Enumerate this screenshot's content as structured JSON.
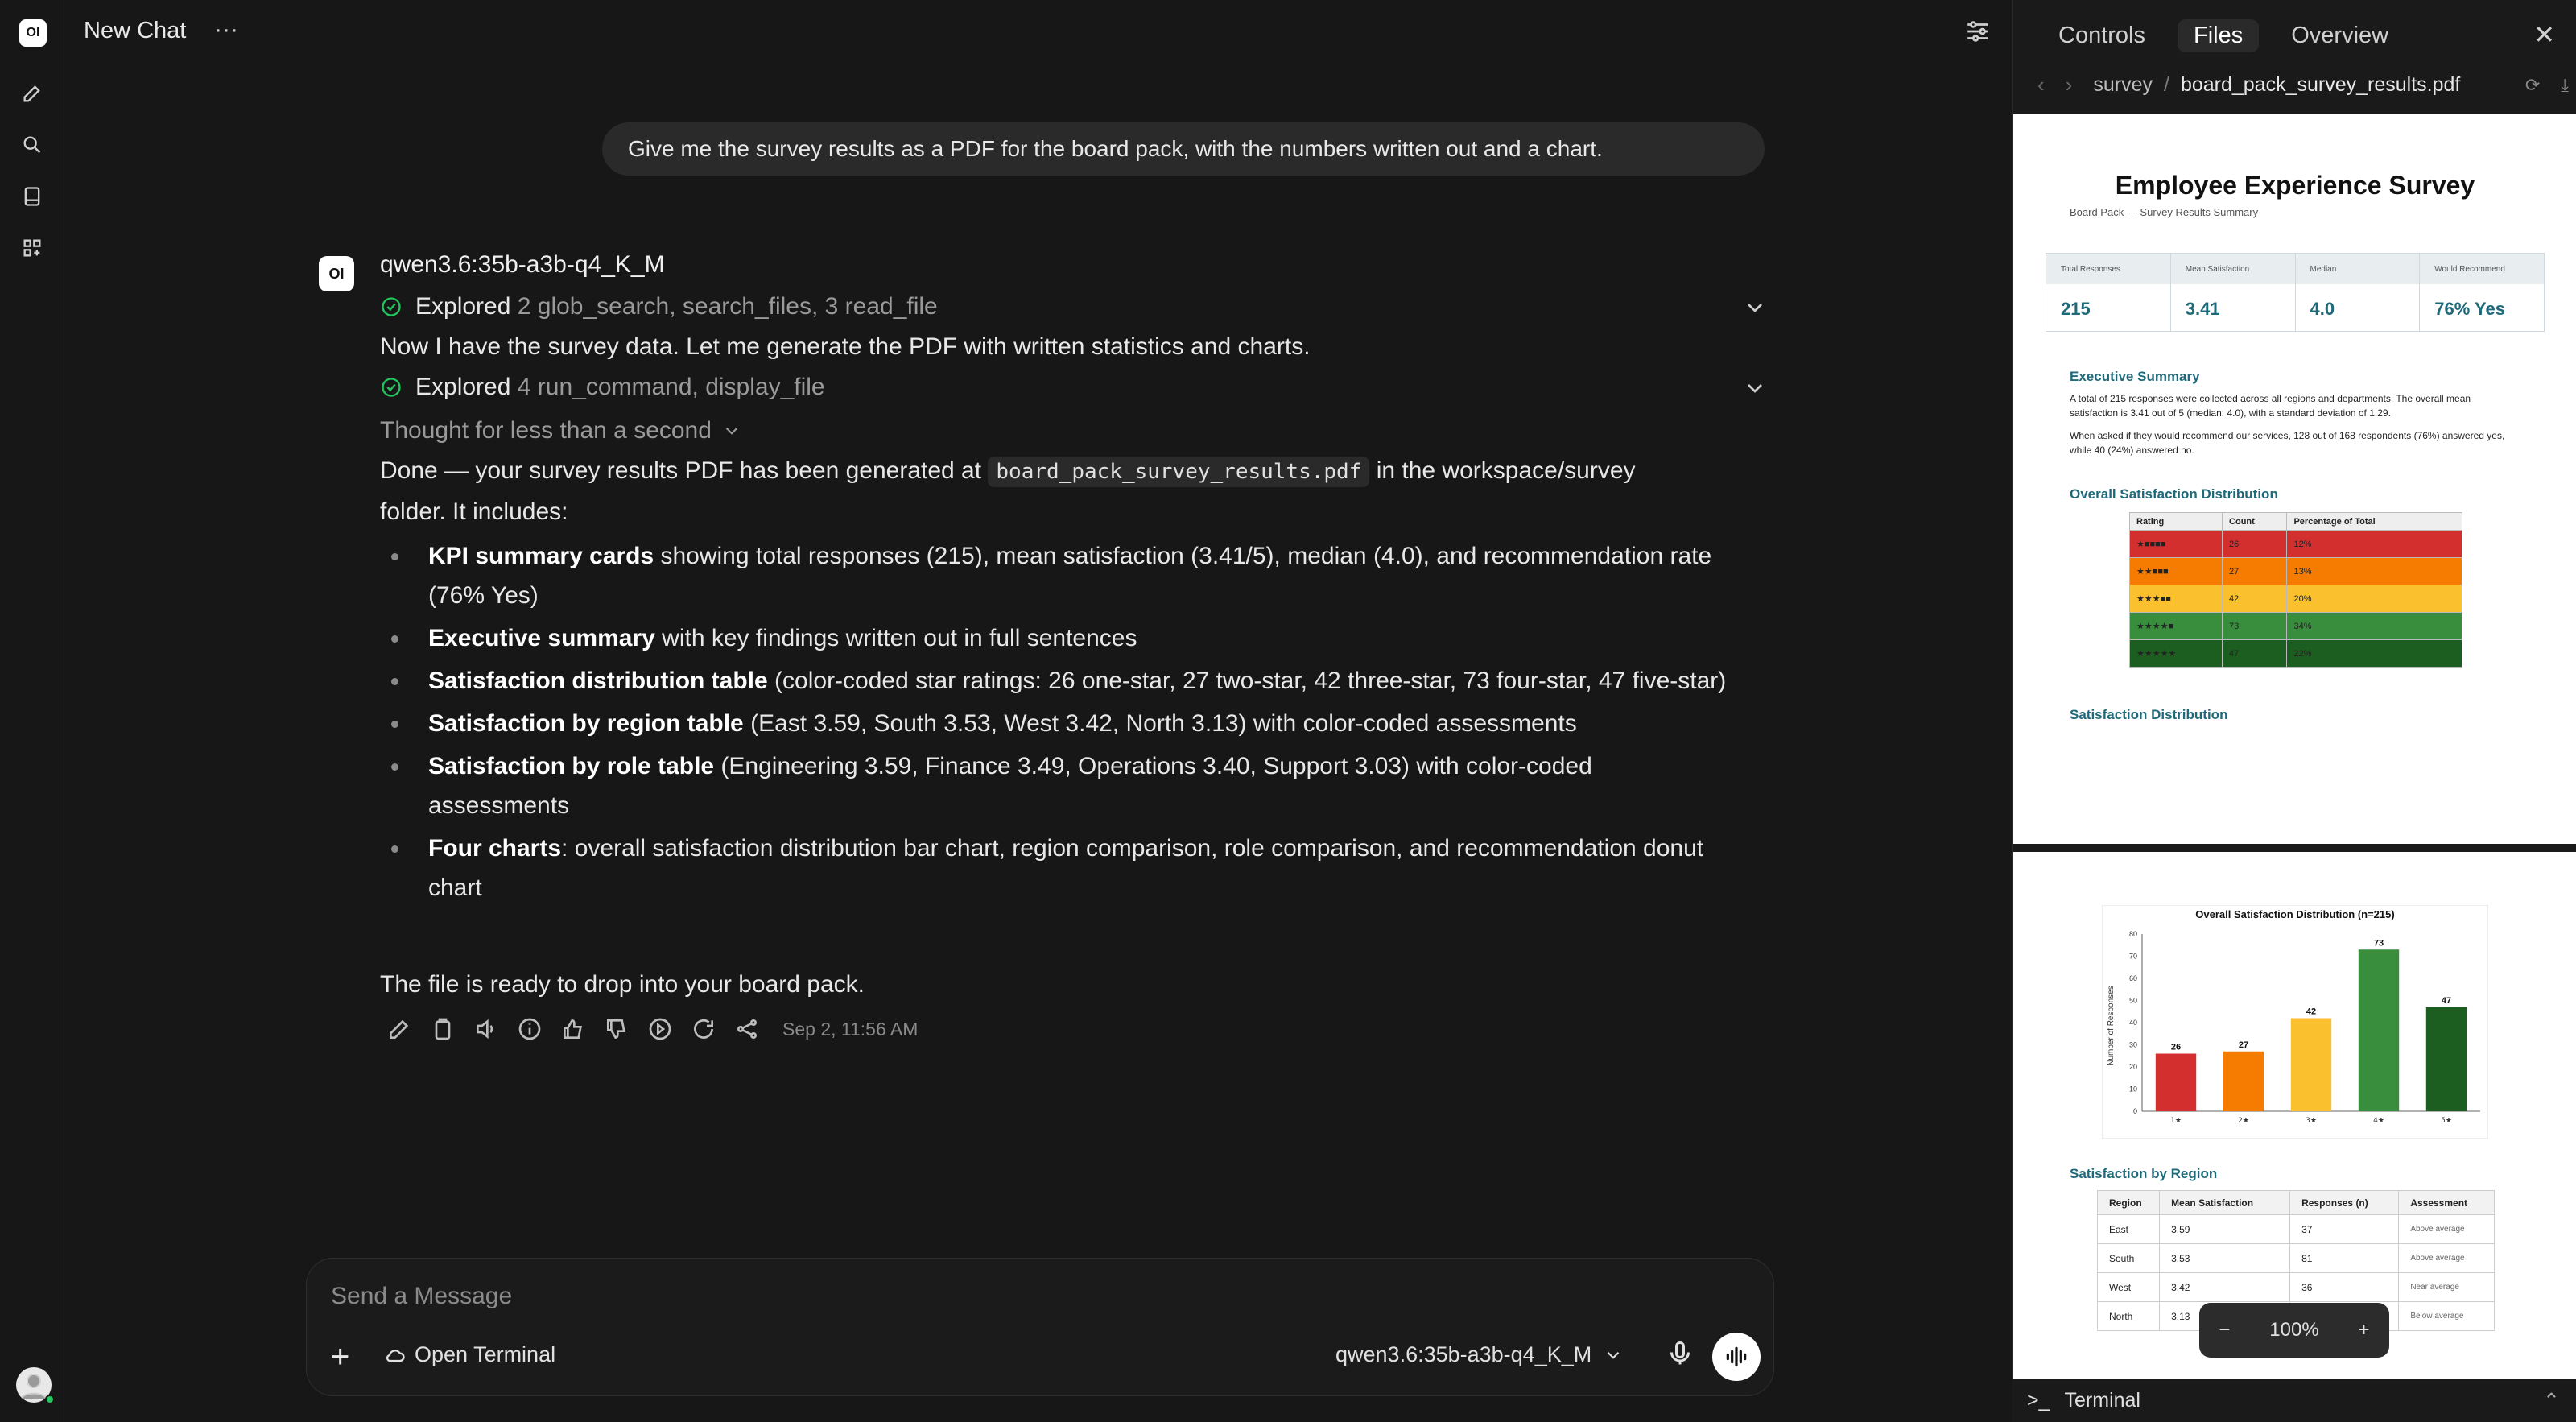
{
  "header": {
    "title": "New Chat",
    "more": "···"
  },
  "chat": {
    "user_message": "Give me the survey results as a PDF for the board pack, with the numbers written out and a chart.",
    "model_name": "qwen3.6:35b-a3b-q4_K_M",
    "explored1_label": "Explored",
    "explored1_detail": "2 glob_search, search_files, 3 read_file",
    "line1": "Now I have the survey data. Let me generate the PDF with written statistics and charts.",
    "explored2_label": "Explored",
    "explored2_detail": "4 run_command, display_file",
    "thought": "Thought for less than a second",
    "done_pre": "Done — your survey results PDF has been generated at",
    "done_code": "board_pack_survey_results.pdf",
    "done_post": "in the workspace/survey",
    "done_line2": "folder. It includes:",
    "bullets": [
      {
        "b": "KPI summary cards",
        "t": " showing total responses (215), mean satisfaction (3.41/5), median (4.0), and recommendation rate (76% Yes)"
      },
      {
        "b": "Executive summary",
        "t": " with key findings written out in full sentences"
      },
      {
        "b": "Satisfaction distribution table",
        "t": " (color-coded star ratings: 26 one-star, 27 two-star, 42 three-star, 73 four-star, 47 five-star)"
      },
      {
        "b": "Satisfaction by region table",
        "t": " (East 3.59, South 3.53, West 3.42, North 3.13) with color-coded assessments"
      },
      {
        "b": "Satisfaction by role table",
        "t": " (Engineering 3.59, Finance 3.49, Operations 3.40, Support 3.03) with color-coded assessments"
      },
      {
        "b": "Four charts",
        "t": ": overall satisfaction distribution bar chart, region comparison, role comparison, and recommendation donut chart"
      }
    ],
    "closing": "The file is ready to drop into your board pack.",
    "timestamp": "Sep 2, 11:56 AM"
  },
  "composer": {
    "placeholder": "Send a Message",
    "terminal_label": "Open Terminal",
    "model": "qwen3.6:35b-a3b-q4_K_M"
  },
  "panel": {
    "tabs": [
      "Controls",
      "Files",
      "Overview"
    ],
    "crumb_folder": "survey",
    "crumb_sep": "/",
    "crumb_file": "board_pack_survey_results.pdf",
    "zoom": "100%",
    "zoom_minus": "−",
    "zoom_plus": "+",
    "terminal": "Terminal"
  },
  "pdf": {
    "title": "Employee Experience Survey",
    "subtitle": "Board Pack — Survey Results Summary",
    "kpis": [
      {
        "label": "Total Responses",
        "value": "215"
      },
      {
        "label": "Mean Satisfaction",
        "value": "3.41"
      },
      {
        "label": "Median",
        "value": "4.0"
      },
      {
        "label": "Would Recommend",
        "value": "76% Yes"
      }
    ],
    "exec_heading": "Executive Summary",
    "exec_p1": "A total of 215 responses were collected across all regions and departments. The overall mean satisfaction is 3.41 out of 5 (median: 4.0), with a standard deviation of 1.29.",
    "exec_p2": "When asked if they would recommend our services, 128 out of 168 respondents (76%) answered yes, while 40 (24%) answered no.",
    "dist_heading": "Overall Satisfaction Distribution",
    "dist_cols": [
      "Rating",
      "Count",
      "Percentage of Total"
    ],
    "dist_rows": [
      {
        "rating": "★■■■■",
        "count": "26",
        "pct": "12%",
        "color": "#d32f2f"
      },
      {
        "rating": "★★■■■",
        "count": "27",
        "pct": "13%",
        "color": "#f57c00"
      },
      {
        "rating": "★★★■■",
        "count": "42",
        "pct": "20%",
        "color": "#fbc02d"
      },
      {
        "rating": "★★★★■",
        "count": "73",
        "pct": "34%",
        "color": "#388e3c"
      },
      {
        "rating": "★★★★★",
        "count": "47",
        "pct": "22%",
        "color": "#1b5e20"
      }
    ],
    "sat_dist_heading": "Satisfaction Distribution",
    "region_heading": "Satisfaction by Region",
    "region_cols": [
      "Region",
      "Mean Satisfaction",
      "Responses (n)",
      "Assessment"
    ],
    "region_rows": [
      {
        "region": "East",
        "mean": "3.59",
        "n": "37",
        "assess": "Above average"
      },
      {
        "region": "South",
        "mean": "3.53",
        "n": "81",
        "assess": "Above average"
      },
      {
        "region": "West",
        "mean": "3.42",
        "n": "36",
        "assess": "Near average"
      },
      {
        "region": "North",
        "mean": "3.13",
        "n": "",
        "assess": "Below average"
      }
    ]
  },
  "chart_data": {
    "type": "bar",
    "title": "Overall Satisfaction Distribution (n=215)",
    "categories": [
      "1★",
      "2★",
      "3★",
      "4★",
      "5★"
    ],
    "values": [
      26,
      27,
      42,
      73,
      47
    ],
    "colors": [
      "#d32f2f",
      "#f57c00",
      "#fbc02d",
      "#388e3c",
      "#1b5e20"
    ],
    "ylabel": "Number of Responses",
    "yticks": [
      "0",
      "10",
      "20",
      "30",
      "40",
      "50",
      "60",
      "70",
      "80"
    ],
    "ylim": [
      0,
      80
    ],
    "grid": false
  }
}
